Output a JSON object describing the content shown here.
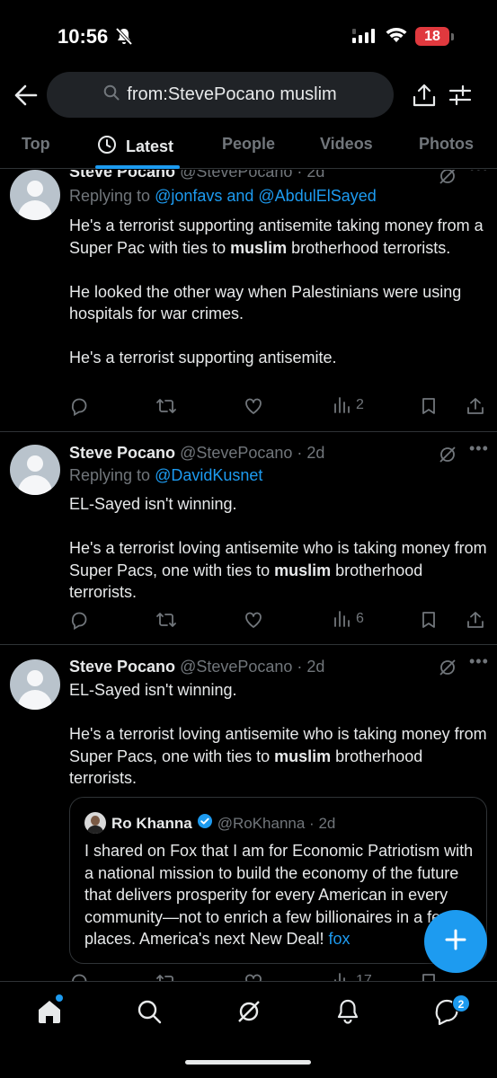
{
  "status_bar": {
    "time": "10:56",
    "battery": "18"
  },
  "search": {
    "query": "from:StevePocano muslim"
  },
  "tabs": [
    {
      "label": "Top"
    },
    {
      "label": "Latest"
    },
    {
      "label": "People"
    },
    {
      "label": "Videos"
    },
    {
      "label": "Photos"
    }
  ],
  "tweets": [
    {
      "name": "Steve Pocano",
      "handle_time": "@StevePocano · 2d",
      "replying_prefix": "Replying to ",
      "replying_to": "@jonfavs and @AbdulElSayed",
      "p1_a": "He's a terrorist supporting antisemite taking money from a Super Pac with ties to ",
      "p1_bold": "muslim",
      "p1_b": " brotherhood terrorists.",
      "p2": "He looked the other way when Palestinians were using hospitals for war crimes.",
      "p3": "He's a terrorist supporting antisemite.",
      "views": "2"
    },
    {
      "name": "Steve Pocano",
      "handle_time": "@StevePocano · 2d",
      "replying_prefix": "Replying to ",
      "replying_to": "@DavidKusnet",
      "p1": "EL-Sayed isn't winning.",
      "p2_a": "He's a terrorist loving antisemite who is taking money from Super Pacs, one with ties to ",
      "p2_bold": "muslim",
      "p2_b": " brotherhood terrorists.",
      "views": "6"
    },
    {
      "name": "Steve Pocano",
      "handle_time": "@StevePocano · 2d",
      "p1": "EL-Sayed isn't winning.",
      "p2_a": "He's a terrorist loving antisemite who is taking money from Super Pacs, one with ties to ",
      "p2_bold": "muslim",
      "p2_b": " brotherhood terrorists.",
      "views": "17",
      "quote": {
        "name": "Ro Khanna",
        "handle_time": "@RoKhanna · 2d",
        "text": "I shared on Fox that I am for Economic Patriotism with a national mission to build the economy of the future that delivers prosperity for every American in every community—not to enrich a few billionaires in a few places. America's next New Deal! ",
        "link": "fox"
      }
    }
  ],
  "bottom_nav": {
    "messages_badge": "2"
  },
  "colors": {
    "accent": "#1d9bf0",
    "background": "#000000",
    "muted": "#71767b",
    "text": "#e7e9ea",
    "divider": "#2f3336"
  }
}
